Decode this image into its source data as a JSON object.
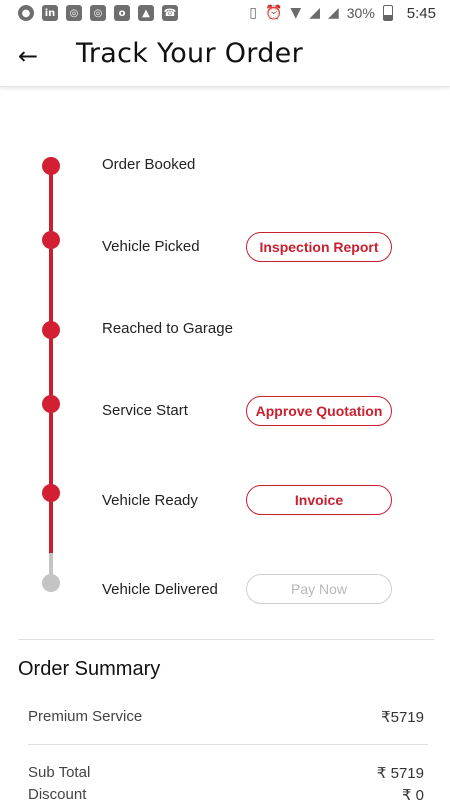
{
  "status_bar": {
    "battery_percent": "30%",
    "time": "5:45",
    "icons": [
      "record-icon",
      "linkedin-icon",
      "instagram-icon",
      "instagram-icon",
      "outlook-icon",
      "gallery-icon",
      "phone-icon"
    ]
  },
  "header": {
    "back_icon": "←",
    "title": "Track Your Order"
  },
  "timeline": {
    "steps": [
      {
        "label": "Order Booked",
        "status": "done",
        "button": ""
      },
      {
        "label": "Vehicle Picked",
        "status": "done",
        "button": "Inspection Report"
      },
      {
        "label": "Reached to Garage",
        "status": "done",
        "button": ""
      },
      {
        "label": "Service Start",
        "status": "done",
        "button": "Approve Quotation"
      },
      {
        "label": "Vehicle Ready",
        "status": "done",
        "button": "Invoice"
      },
      {
        "label": "Vehicle Delivered",
        "status": "pending",
        "button": "Pay Now"
      }
    ]
  },
  "summary": {
    "title": "Order Summary",
    "items": [
      {
        "label": "Premium Service",
        "amount": "₹5719"
      }
    ],
    "sub_total": {
      "label": "Sub Total",
      "amount": "₹ 5719"
    },
    "discount": {
      "label": "Discount",
      "amount": "₹ 0"
    }
  },
  "colors": {
    "accent": "#c8202f",
    "pending": "#c4c4c4"
  }
}
